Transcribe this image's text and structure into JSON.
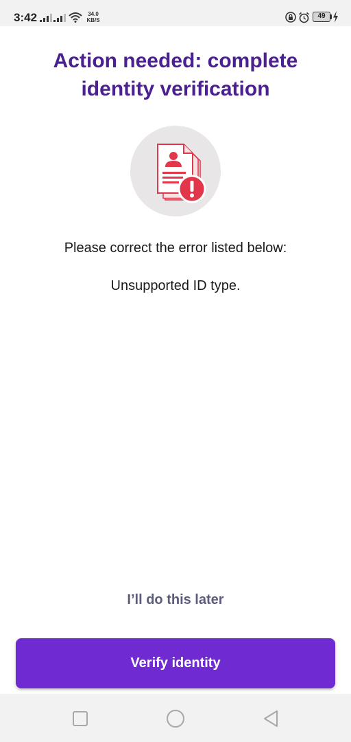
{
  "status_bar": {
    "time": "3:42",
    "net_speed_value": "34.0",
    "net_speed_unit": "KB/S",
    "battery_level": "49",
    "icons": [
      "signal-icon",
      "signal-icon",
      "wifi-icon",
      "lock-icon",
      "alarm-icon",
      "battery-icon",
      "charging-icon"
    ]
  },
  "page": {
    "title": "Action needed: complete identity verification",
    "illustration_icon": "document-error-icon",
    "instruction": "Please correct the error listed below:",
    "error_message": "Unsupported ID type.",
    "later_link": "I’ll do this later",
    "verify_button": "Verify identity"
  },
  "nav_bar": {
    "icons": [
      "recent-apps-icon",
      "home-icon",
      "back-icon"
    ]
  },
  "colors": {
    "title": "#4b2091",
    "button": "#6f2bd1",
    "error_red": "#e2364b",
    "link": "#5b5b7a"
  }
}
